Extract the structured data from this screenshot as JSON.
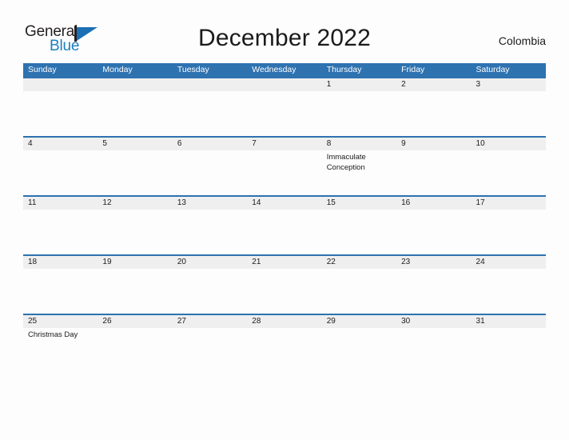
{
  "brand": {
    "name_part1": "General",
    "name_part2": "Blue",
    "mark_icon": "triangle-flag-icon",
    "color_blue": "#1a6fb5",
    "color_text": "#231f20"
  },
  "header": {
    "title": "December 2022",
    "locale": "Colombia"
  },
  "calendar": {
    "accent_color": "#2e72b0",
    "band_color": "#efefef",
    "weekdays": [
      "Sunday",
      "Monday",
      "Tuesday",
      "Wednesday",
      "Thursday",
      "Friday",
      "Saturday"
    ],
    "weeks": [
      {
        "days": [
          {
            "number": "",
            "events": []
          },
          {
            "number": "",
            "events": []
          },
          {
            "number": "",
            "events": []
          },
          {
            "number": "",
            "events": []
          },
          {
            "number": "1",
            "events": []
          },
          {
            "number": "2",
            "events": []
          },
          {
            "number": "3",
            "events": []
          }
        ]
      },
      {
        "days": [
          {
            "number": "4",
            "events": []
          },
          {
            "number": "5",
            "events": []
          },
          {
            "number": "6",
            "events": []
          },
          {
            "number": "7",
            "events": []
          },
          {
            "number": "8",
            "events": [
              "Immaculate Conception"
            ]
          },
          {
            "number": "9",
            "events": []
          },
          {
            "number": "10",
            "events": []
          }
        ]
      },
      {
        "days": [
          {
            "number": "11",
            "events": []
          },
          {
            "number": "12",
            "events": []
          },
          {
            "number": "13",
            "events": []
          },
          {
            "number": "14",
            "events": []
          },
          {
            "number": "15",
            "events": []
          },
          {
            "number": "16",
            "events": []
          },
          {
            "number": "17",
            "events": []
          }
        ]
      },
      {
        "days": [
          {
            "number": "18",
            "events": []
          },
          {
            "number": "19",
            "events": []
          },
          {
            "number": "20",
            "events": []
          },
          {
            "number": "21",
            "events": []
          },
          {
            "number": "22",
            "events": []
          },
          {
            "number": "23",
            "events": []
          },
          {
            "number": "24",
            "events": []
          }
        ]
      },
      {
        "days": [
          {
            "number": "25",
            "events": [
              "Christmas Day"
            ]
          },
          {
            "number": "26",
            "events": []
          },
          {
            "number": "27",
            "events": []
          },
          {
            "number": "28",
            "events": []
          },
          {
            "number": "29",
            "events": []
          },
          {
            "number": "30",
            "events": []
          },
          {
            "number": "31",
            "events": []
          }
        ]
      }
    ]
  }
}
